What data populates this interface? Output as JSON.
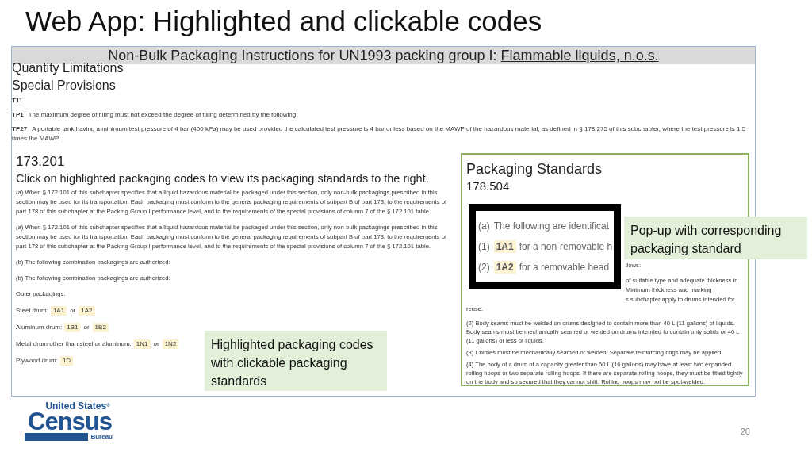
{
  "slide": {
    "title": "Web App: Highlighted and clickable codes",
    "page_number": "20"
  },
  "logo": {
    "top": "United States",
    "mark": "®",
    "main": "Census",
    "bottom": "Bureau"
  },
  "app": {
    "header": {
      "text": "Non-Bulk Packaging Instructions for UN1993 packing group I: ",
      "link": "Flammable liquids, n.o.s."
    },
    "sections": [
      "Quantity Limitations",
      "Special Provisions"
    ],
    "provisions": [
      {
        "code": "T11"
      },
      {
        "code": "TP1",
        "text": "The maximum degree of filling must not exceed the degree of filling determined by the following:"
      },
      {
        "code": "TP27",
        "text": "A portable tank having a minimum test pressure of 4 bar (400 kPa) may be used provided the calculated test pressure is 4 bar or less based on the MAWP of the hazardous material, as defined in § 178.275 of this subchapter, where the test pressure is 1.5 times the MAWP."
      }
    ],
    "left": {
      "section": "173.201",
      "instruction": "Click on highlighted packaging codes to view its packaging standards to the right.",
      "paragraphs": [
        "(a) When § 172.101 of this subchapter specifies that a liquid hazardous material be packaged under this section, only non-bulk packagings prescribed in this section may be used for its transportation. Each packaging must conform to the general packaging requirements of subpart B of part 173, to the requirements of part 178 of this subchapter at the Packing Group I performance level, and to the requirements of the special provisions of column 7 of the § 172.101 table.",
        "(a) When § 172.101 of this subchapter specifies that a liquid hazardous material be packaged under this section, only non-bulk packagings prescribed in this section may be used for its transportation. Each packaging must conform to the general packaging requirements of subpart B of part 173, to the requirements of part 178 of this subchapter at the Packing Group I performance level, and to the requirements of the special provisions of column 7 of the § 172.101 table.",
        "(b) The following combination packagings are authorized:",
        "(b) The following combination packagings are authorized:",
        "Outer packagings:"
      ],
      "items": [
        {
          "label": "Steel drum:",
          "codes": [
            {
              "code": "1A1",
              "highlighted": true
            },
            {
              "code": "1A2",
              "highlighted": true
            }
          ],
          "separator": "or"
        },
        {
          "label": "Aluminum drum:",
          "codes": [
            {
              "code": "1B1",
              "highlighted": true
            },
            {
              "code": "1B2",
              "highlighted": true
            }
          ],
          "separator": "or"
        },
        {
          "label": "Metal drum other than steel or aluminum:",
          "codes": [
            {
              "code": "1N1",
              "highlighted": true
            },
            {
              "code": "1N2",
              "highlighted": true
            }
          ],
          "separator": "or"
        },
        {
          "label": "Plywood drum:",
          "codes": [
            {
              "code": "1D",
              "highlighted": true
            }
          ]
        }
      ]
    },
    "right": {
      "title": "Packaging Standards",
      "section": "178.504",
      "fragments": [
        {
          "kind": "fragment",
          "text": "llows:"
        },
        {
          "kind": "fragment",
          "text": "of suitable type and adequate thickness in"
        },
        {
          "kind": "fragment",
          "text": "Minimum thickness and marking"
        },
        {
          "kind": "fragment",
          "text": "s subchapter apply to drums intended for"
        },
        {
          "kind": "full",
          "text": "reuse."
        }
      ],
      "paragraphs": [
        "(2) Body seams must be welded on drums designed to contain more than 40 L (11 gallons) of liquids. Body seams must be mechanically seamed or welded on drums intended to contain only solids or 40 L (11 gallons) or less of liquids.",
        "(3) Chimes must be mechanically seamed or welded. Separate reinforcing rings may be applied.",
        "(4) The body of a drum of a capacity greater than 60 L (16 gallons) may have at least two expanded rolling hoops or two separate rolling hoops. If there are separate rolling hoops, they must be fitted tightly on the body and so secured that they cannot shift. Rolling hoops may not be spot-welded."
      ]
    },
    "popup": {
      "lines": [
        {
          "prefix": "(a)",
          "text": "The following are identificat"
        },
        {
          "prefix": "(1)",
          "code": "1A1",
          "text": "for a non-removable h"
        },
        {
          "prefix": "(2)",
          "code": "1A2",
          "text": "for a removable head"
        }
      ]
    }
  },
  "callouts": [
    {
      "kind": "codes",
      "text": "Highlighted packaging codes with clickable packaging standards"
    },
    {
      "kind": "popup",
      "text": "Pop-up with corresponding packaging standard"
    }
  ]
}
